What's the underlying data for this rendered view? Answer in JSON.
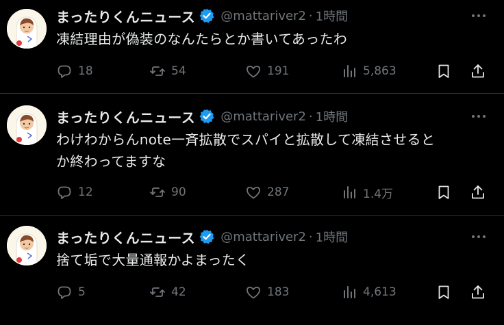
{
  "account": {
    "name": "まったりくんニュース",
    "handle": "@mattariver2",
    "separator": "·",
    "verified_color": "#1d9bf0"
  },
  "tweets": [
    {
      "time": "1時間",
      "text": "凍結理由が偽装のなんたらとか書いてあったわ",
      "replies": "18",
      "retweets": "54",
      "likes": "191",
      "views": "5,863"
    },
    {
      "time": "1時間",
      "text": "わけわからんnote一斉拡散でスパイと拡散して凍結させると\nか終わってますな",
      "replies": "12",
      "retweets": "90",
      "likes": "287",
      "views": "1.4万"
    },
    {
      "time": "1時間",
      "text": "捨て垢で大量通報かよまったく",
      "replies": "5",
      "retweets": "42",
      "likes": "183",
      "views": "4,613"
    }
  ],
  "colors": {
    "background": "#000000",
    "text": "#e7e9ea",
    "muted": "#71767b",
    "divider": "#2f3336"
  },
  "icons": [
    "reply-icon",
    "retweet-icon",
    "like-icon",
    "views-icon",
    "bookmark-icon",
    "share-icon",
    "more-icon",
    "verified-badge-icon"
  ]
}
